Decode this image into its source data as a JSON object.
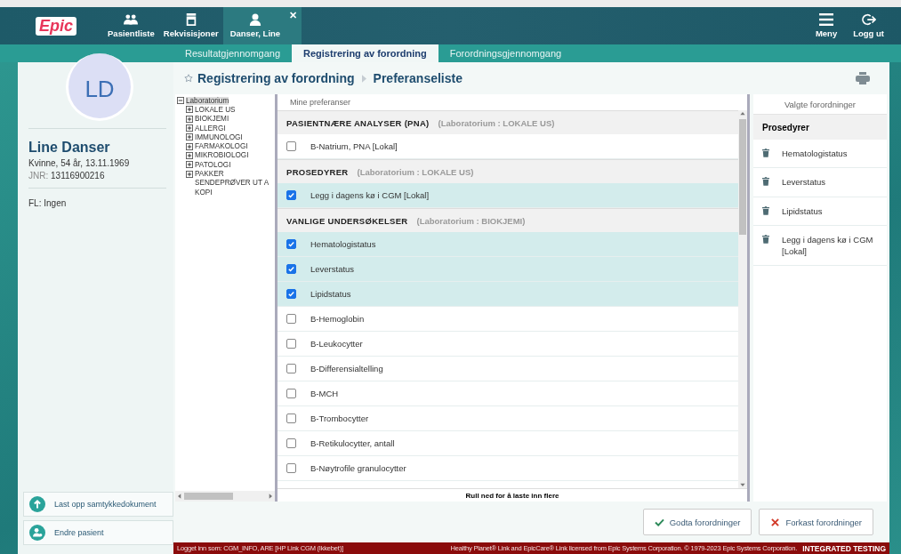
{
  "header": {
    "logo": "Epic",
    "items": [
      {
        "label": "Pasientliste",
        "selected": false
      },
      {
        "label": "Rekvisisjoner",
        "selected": false
      },
      {
        "label": "Danser, Line",
        "selected": true,
        "close": "✕"
      }
    ],
    "right": [
      {
        "label": "Meny"
      },
      {
        "label": "Logg ut"
      }
    ]
  },
  "tabs": [
    {
      "label": "Resultatgjennomgang",
      "selected": false
    },
    {
      "label": "Registrering av forordning",
      "selected": true
    },
    {
      "label": "Forordningsgjennomgang",
      "selected": false
    }
  ],
  "patient": {
    "initials": "LD",
    "name": "Line Danser",
    "info": "Kvinne, 54 år, 13.11.1969",
    "id_label": "JNR:",
    "id_value": "13116900216",
    "fl": "FL: Ingen"
  },
  "patient_actions": [
    {
      "label": "Last opp samtykkedokument"
    },
    {
      "label": "Endre pasient"
    }
  ],
  "breadcrumb": [
    "Registrering av forordning",
    "Preferanseliste"
  ],
  "tree": {
    "label": "Laboratorium",
    "expanded": true,
    "selected": true,
    "children": [
      {
        "label": "LOKALE US",
        "expandable": true
      },
      {
        "label": "BIOKJEMI",
        "expandable": true
      },
      {
        "label": "ALLERGI",
        "expandable": true
      },
      {
        "label": "IMMUNOLOGI",
        "expandable": true
      },
      {
        "label": "FARMAKOLOGI",
        "expandable": true
      },
      {
        "label": "MIKROBIOLOGI",
        "expandable": true
      },
      {
        "label": "PATOLOGI",
        "expandable": true
      },
      {
        "label": "PAKKER",
        "expandable": true
      },
      {
        "label": "SENDEPRØVER UT A",
        "expandable": false
      },
      {
        "label": "KOPI",
        "expandable": false
      }
    ]
  },
  "preferences": {
    "title": "Mine preferanser",
    "rows": [
      {
        "kind": "header",
        "label": "PASIENTNÆRE ANALYSER (PNA)",
        "source": "(Laboratorium : LOKALE US)"
      },
      {
        "kind": "item",
        "label": "B-Natrium, PNA [Lokal]",
        "checked": false
      },
      {
        "kind": "header",
        "label": "PROSEDYRER",
        "source": "(Laboratorium : LOKALE US)"
      },
      {
        "kind": "item",
        "label": "Legg i dagens kø i CGM [Lokal]",
        "checked": true
      },
      {
        "kind": "header",
        "label": "VANLIGE UNDERSØKELSER",
        "source": "(Laboratorium : BIOKJEMI)"
      },
      {
        "kind": "item",
        "label": "Hematologistatus",
        "checked": true
      },
      {
        "kind": "item",
        "label": "Leverstatus",
        "checked": true
      },
      {
        "kind": "item",
        "label": "Lipidstatus",
        "checked": true
      },
      {
        "kind": "item",
        "label": "B-Hemoglobin",
        "checked": false
      },
      {
        "kind": "item",
        "label": "B-Leukocytter",
        "checked": false
      },
      {
        "kind": "item",
        "label": "B-Differensialtelling",
        "checked": false
      },
      {
        "kind": "item",
        "label": "B-MCH",
        "checked": false
      },
      {
        "kind": "item",
        "label": "B-Trombocytter",
        "checked": false
      },
      {
        "kind": "item",
        "label": "B-Retikulocytter, antall",
        "checked": false
      },
      {
        "kind": "item",
        "label": "B-Nøytrofile granulocytter",
        "checked": false
      }
    ],
    "footer": "Rull ned for å laste inn flere"
  },
  "selected_orders": {
    "title": "Valgte forordninger",
    "group": "Prosedyrer",
    "items": [
      "Hematologistatus",
      "Leverstatus",
      "Lipidstatus",
      "Legg i dagens kø i CGM [Lokal]"
    ]
  },
  "buttons": [
    {
      "label": "Godta forordninger",
      "kind": "accept"
    },
    {
      "label": "Forkast forordninger",
      "kind": "discard"
    }
  ],
  "status_bar": {
    "login": "Logget inn som: CGM_INFO, ARE [HP Link CGM (Ikkebet)]",
    "license": "Healthy Planet® Link and EpicCare® Link licensed from Epic Systems Corporation. © 1979-2023 Epic Systems Corporation.",
    "environment": "INTEGRATED TESTING"
  }
}
